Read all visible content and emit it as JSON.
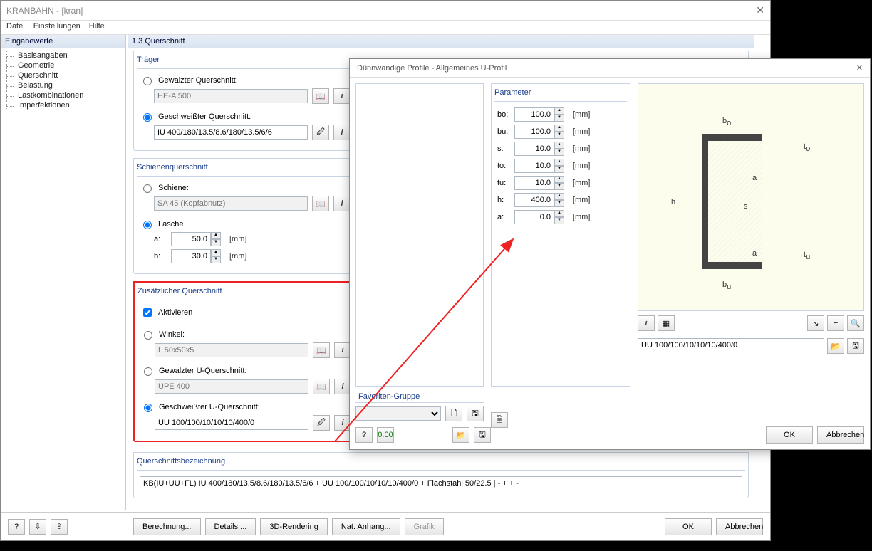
{
  "app": {
    "title": "KRANBAHN - [kran]"
  },
  "menu": [
    "Datei",
    "Einstellungen",
    "Hilfe"
  ],
  "nav": {
    "header": "Eingabewerte",
    "items": [
      "Basisangaben",
      "Geometrie",
      "Querschnitt",
      "Belastung",
      "Lastkombinationen",
      "Imperfektionen"
    ]
  },
  "section_title": "1.3 Querschnitt",
  "traeger": {
    "legend": "Träger",
    "rolled_label": "Gewalzter Querschnitt:",
    "rolled_value": "HE-A 500",
    "welded_label": "Geschweißter Querschnitt:",
    "welded_value": "IU 400/180/13.5/8.6/180/13.5/6/6"
  },
  "schiene": {
    "legend": "Schienenquerschnitt",
    "rail_label": "Schiene:",
    "rail_value": "SA 45 (Kopfabnutz)",
    "lasche_label": "Lasche",
    "a_label": "a:",
    "a_value": "50.0",
    "a_unit": "[mm]",
    "b_label": "b:",
    "b_value": "30.0",
    "b_unit": "[mm]"
  },
  "zusatz": {
    "legend": "Zusätzlicher Querschnitt",
    "activate": "Aktivieren",
    "angle_label": "Winkel:",
    "angle_value": "L 50x50x5",
    "rolledU_label": "Gewalzter U-Querschnitt:",
    "rolledU_value": "UPE 400",
    "weldedU_label": "Geschweißter U-Querschnitt:",
    "weldedU_value": "UU 100/100/10/10/10/400/0"
  },
  "qsbez": {
    "legend": "Querschnittsbezeichnung",
    "value": "KB(IU+UU+FL) IU 400/180/13.5/8.6/180/13.5/6/6 + UU 100/100/10/10/10/400/0 + Flachstahl 50/22.5 | - + + -"
  },
  "footer": {
    "calc": "Berechnung...",
    "details": "Details ...",
    "render": "3D-Rendering",
    "annex": "Nat. Anhang...",
    "grafik": "Grafik",
    "ok": "OK",
    "cancel": "Abbrechen"
  },
  "dialog": {
    "title": "Dünnwandige Profile - Allgemeines U-Profil",
    "param_legend": "Parameter",
    "fav_legend": "Favoriten-Gruppe",
    "params": [
      {
        "sym": "bo:",
        "val": "100.0",
        "unit": "[mm]"
      },
      {
        "sym": "bu:",
        "val": "100.0",
        "unit": "[mm]"
      },
      {
        "sym": "s:",
        "val": "10.0",
        "unit": "[mm]"
      },
      {
        "sym": "to:",
        "val": "10.0",
        "unit": "[mm]"
      },
      {
        "sym": "tu:",
        "val": "10.0",
        "unit": "[mm]"
      },
      {
        "sym": "h:",
        "val": "400.0",
        "unit": "[mm]"
      },
      {
        "sym": "a:",
        "val": "0.0",
        "unit": "[mm]"
      }
    ],
    "designation": "UU 100/100/10/10/10/400/0",
    "ok": "OK",
    "cancel": "Abbrechen"
  },
  "chart_data": {
    "type": "diagram",
    "profile": "U",
    "labels": [
      "bo",
      "bu",
      "s",
      "to",
      "tu",
      "h",
      "a"
    ],
    "values": [
      100.0,
      100.0,
      10.0,
      10.0,
      10.0,
      400.0,
      0.0
    ],
    "unit": "mm"
  }
}
